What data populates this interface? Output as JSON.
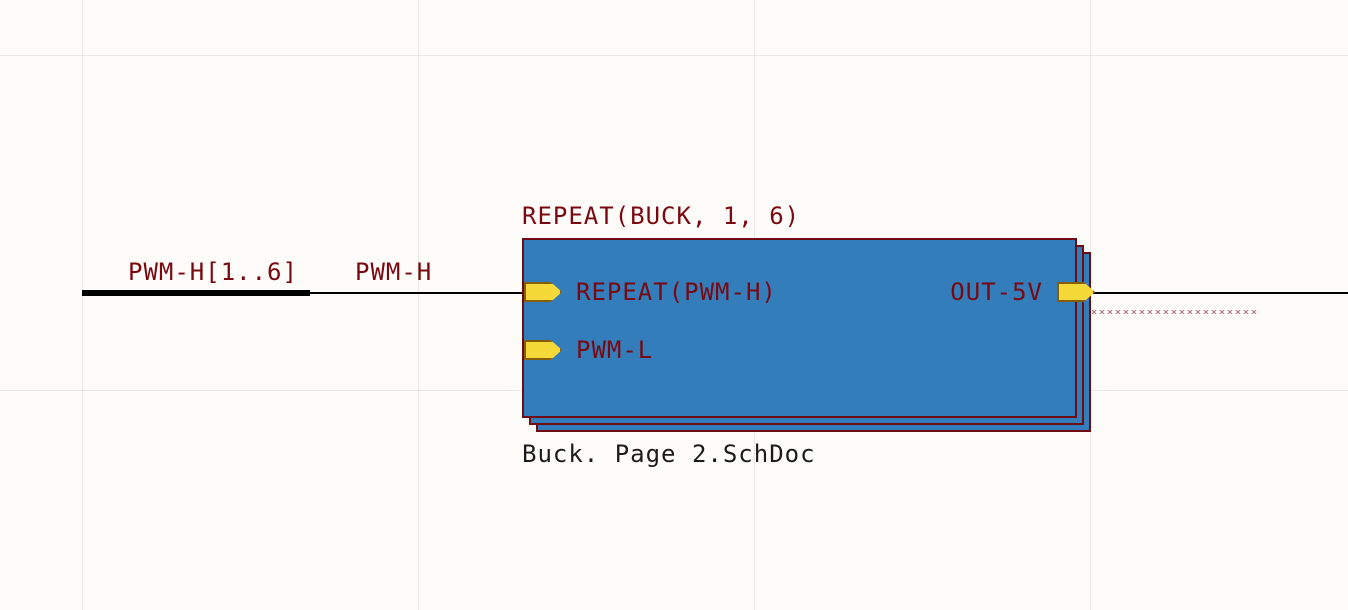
{
  "designator": "REPEAT(BUCK, 1, 6)",
  "filename": "Buck. Page 2.SchDoc",
  "bus_label": "PWM-H[1..6]",
  "net_label": "PWM-H",
  "ports": {
    "in_top": "REPEAT(PWM-H)",
    "in_bottom": "PWM-L",
    "out_right": "OUT-5V"
  }
}
